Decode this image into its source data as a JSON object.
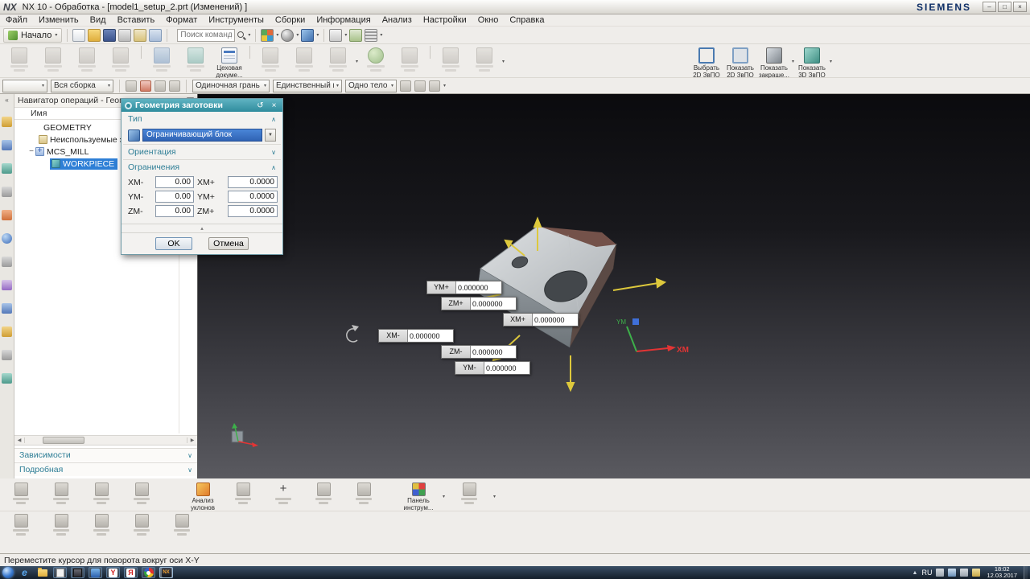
{
  "titlebar": {
    "logo": "NX",
    "title": "NX 10 - Обработка - [model1_setup_2.prt (Изменений) ]",
    "brand": "SIEMENS"
  },
  "menubar": {
    "items": [
      "Файл",
      "Изменить",
      "Вид",
      "Вставить",
      "Формат",
      "Инструменты",
      "Сборки",
      "Информация",
      "Анализ",
      "Настройки",
      "Окно",
      "Справка"
    ]
  },
  "toolbar1": {
    "start_label": "Начало",
    "search_placeholder": "Поиск команды"
  },
  "ribbon": {
    "shop_doc_label": "Цеховая докуме...",
    "right_buttons": [
      {
        "label": "Выбрать 2D ЗвПО"
      },
      {
        "label": "Показать 2D ЗвПО"
      },
      {
        "label": "Показать закраше..."
      },
      {
        "label": "Показать 3D ЗвПО"
      }
    ]
  },
  "selection_bar": {
    "combos": [
      {
        "value": ""
      },
      {
        "value": "Вся сборка"
      },
      {
        "value": "Одиночная грань"
      },
      {
        "value": "Единственный кри"
      },
      {
        "value": "Одно тело"
      }
    ]
  },
  "navigator": {
    "title": "Навигатор операций - Геометрия",
    "column_header": "Имя",
    "rows": [
      {
        "label": "GEOMETRY"
      },
      {
        "label": "Неиспользуемые элемент"
      },
      {
        "label": "MCS_MILL"
      },
      {
        "label": "WORKPIECE"
      }
    ],
    "sections": [
      {
        "label": "Зависимости"
      },
      {
        "label": "Подробная"
      }
    ]
  },
  "dialog": {
    "title": "Геометрия заготовки",
    "type_section": "Тип",
    "type_value": "Ограничивающий блок",
    "orientation_section": "Ориентация",
    "limits_section": "Ограничения",
    "limits": [
      {
        "neg_label": "XM-",
        "neg_value": "0.00",
        "pos_label": "XM+",
        "pos_value": "0.0000"
      },
      {
        "neg_label": "YM-",
        "neg_value": "0.00",
        "pos_label": "YM+",
        "pos_value": "0.0000"
      },
      {
        "neg_label": "ZM-",
        "neg_value": "0.00",
        "pos_label": "ZM+",
        "pos_value": "0.0000"
      }
    ],
    "ok_label": "OK",
    "cancel_label": "Отмена"
  },
  "viewport": {
    "handles": [
      {
        "label": "YM+",
        "value": "0.000000"
      },
      {
        "label": "ZM+",
        "value": "0.000000"
      },
      {
        "label": "XM+",
        "value": "0.000000"
      },
      {
        "label": "XM-",
        "value": "0.000000"
      },
      {
        "label": "ZM-",
        "value": "0.000000"
      },
      {
        "label": "YM-",
        "value": "0.000000"
      }
    ],
    "axis_x_label": "XM",
    "axis_y_label": "YM"
  },
  "bottom_toolbar": {
    "draft_analysis_label": "Анализ уклонов",
    "tool_panel_label": "Панель инструм..."
  },
  "status_bar": {
    "message": "Переместите курсор для поворота вокруг оси X-Y"
  },
  "taskbar": {
    "language": "RU",
    "time": "18:02",
    "date": "12.03.2017"
  }
}
